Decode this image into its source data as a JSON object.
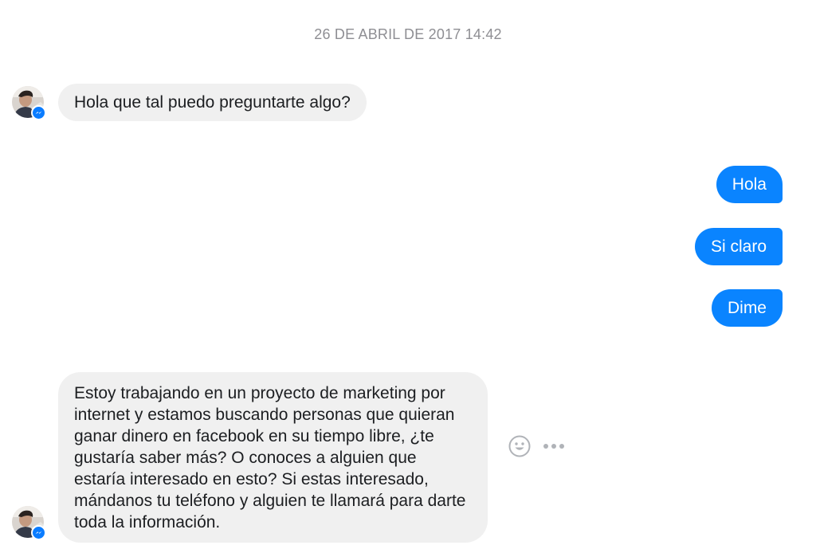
{
  "conversation": {
    "timestamp": "26 DE ABRIL DE 2017 14:42",
    "messages": [
      {
        "direction": "incoming",
        "text": "Hola que tal puedo preguntarte algo?"
      },
      {
        "direction": "outgoing",
        "text": "Hola"
      },
      {
        "direction": "outgoing",
        "text": "Si claro"
      },
      {
        "direction": "outgoing",
        "text": "Dime"
      },
      {
        "direction": "incoming",
        "text": "Estoy trabajando en un proyecto de marketing por internet y estamos buscando personas que quieran ganar dinero en facebook en su tiempo libre, ¿te gustaría saber más? O conoces a alguien que estaría interesado en esto? Si estas interesado, mándanos tu teléfono y alguien te llamará para darte toda la información."
      }
    ]
  },
  "icons": {
    "avatar_badge": "messenger-badge-icon",
    "react": "smiley-react-icon",
    "more": "more-options-icon"
  },
  "colors": {
    "outgoing_bubble": "#0a84ff",
    "incoming_bubble": "#f0f0f0",
    "timestamp": "#8e8e93",
    "badge": "#0a7cff",
    "action_icons": "#b0b3b8"
  }
}
